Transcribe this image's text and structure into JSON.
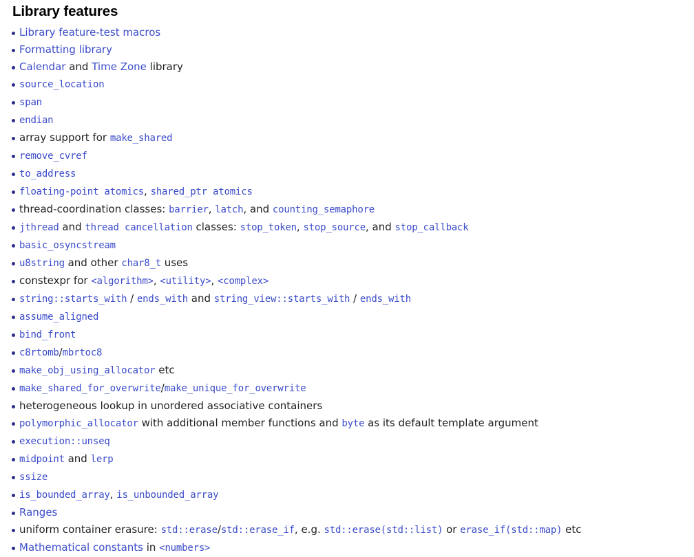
{
  "page": {
    "heading": "Library features"
  },
  "colors": {
    "link": "#3b4cca",
    "text": "#202122",
    "bullet": "#2d2d8c",
    "background": "#ffffff"
  },
  "items": [
    {
      "id": "library-feature-test-macros",
      "parts": [
        {
          "t": "Library feature-test macros",
          "k": "link",
          "m": false
        }
      ]
    },
    {
      "id": "formatting-library",
      "parts": [
        {
          "t": "Formatting library",
          "k": "link",
          "m": false
        }
      ]
    },
    {
      "id": "calendar-and-time-zone-library",
      "parts": [
        {
          "t": "Calendar",
          "k": "link",
          "m": false
        },
        {
          "t": " and ",
          "k": "text",
          "m": false
        },
        {
          "t": "Time Zone",
          "k": "link",
          "m": false
        },
        {
          "t": " library",
          "k": "text",
          "m": false
        }
      ]
    },
    {
      "id": "source-location",
      "parts": [
        {
          "t": "source_location",
          "k": "link",
          "m": true
        }
      ]
    },
    {
      "id": "span",
      "parts": [
        {
          "t": "span",
          "k": "link",
          "m": true
        }
      ]
    },
    {
      "id": "endian",
      "parts": [
        {
          "t": "endian",
          "k": "link",
          "m": true
        }
      ]
    },
    {
      "id": "array-support-for-make-shared",
      "parts": [
        {
          "t": "array support for ",
          "k": "text",
          "m": false
        },
        {
          "t": "make_shared",
          "k": "link",
          "m": true
        }
      ]
    },
    {
      "id": "remove-cvref",
      "parts": [
        {
          "t": "remove_cvref",
          "k": "link",
          "m": true
        }
      ]
    },
    {
      "id": "to-address",
      "parts": [
        {
          "t": "to_address",
          "k": "link",
          "m": true
        }
      ]
    },
    {
      "id": "floating-point-atomics",
      "parts": [
        {
          "t": "floating-point atomics",
          "k": "link",
          "m": true
        },
        {
          "t": ", ",
          "k": "text",
          "m": false
        },
        {
          "t": "shared_ptr atomics",
          "k": "link",
          "m": true
        }
      ]
    },
    {
      "id": "thread-coordination-classes",
      "parts": [
        {
          "t": "thread-coordination classes: ",
          "k": "text",
          "m": false
        },
        {
          "t": "barrier",
          "k": "link",
          "m": true
        },
        {
          "t": ", ",
          "k": "text",
          "m": false
        },
        {
          "t": "latch",
          "k": "link",
          "m": true
        },
        {
          "t": ", and ",
          "k": "text",
          "m": false
        },
        {
          "t": "counting_semaphore",
          "k": "link",
          "m": true
        }
      ]
    },
    {
      "id": "jthread-and-thread-cancellation",
      "parts": [
        {
          "t": "jthread",
          "k": "link",
          "m": true
        },
        {
          "t": " and ",
          "k": "text",
          "m": false
        },
        {
          "t": "thread cancellation",
          "k": "link",
          "m": true
        },
        {
          "t": " classes: ",
          "k": "text",
          "m": false
        },
        {
          "t": "stop_token",
          "k": "link",
          "m": true
        },
        {
          "t": ", ",
          "k": "text",
          "m": false
        },
        {
          "t": "stop_source",
          "k": "link",
          "m": true
        },
        {
          "t": ", and ",
          "k": "text",
          "m": false
        },
        {
          "t": "stop_callback",
          "k": "link",
          "m": true
        }
      ]
    },
    {
      "id": "basic-osyncstream",
      "parts": [
        {
          "t": "basic_osyncstream",
          "k": "link",
          "m": true
        }
      ]
    },
    {
      "id": "u8string-and-char8-t",
      "parts": [
        {
          "t": "u8string",
          "k": "link",
          "m": true
        },
        {
          "t": " and other ",
          "k": "text",
          "m": false
        },
        {
          "t": "char8_t",
          "k": "link",
          "m": true
        },
        {
          "t": " uses",
          "k": "text",
          "m": false
        }
      ]
    },
    {
      "id": "constexpr-for-headers",
      "parts": [
        {
          "t": "constexpr for ",
          "k": "text",
          "m": false
        },
        {
          "t": "<algorithm>",
          "k": "link",
          "m": true
        },
        {
          "t": ", ",
          "k": "text",
          "m": false
        },
        {
          "t": "<utility>",
          "k": "link",
          "m": true
        },
        {
          "t": ", ",
          "k": "text",
          "m": false
        },
        {
          "t": "<complex>",
          "k": "link",
          "m": true
        }
      ]
    },
    {
      "id": "string-starts-with-ends-with",
      "parts": [
        {
          "t": "string::starts_with",
          "k": "link",
          "m": true
        },
        {
          "t": " / ",
          "k": "text",
          "m": false
        },
        {
          "t": "ends_with",
          "k": "link",
          "m": true
        },
        {
          "t": " and ",
          "k": "text",
          "m": false
        },
        {
          "t": "string_view::starts_with",
          "k": "link",
          "m": true
        },
        {
          "t": " / ",
          "k": "text",
          "m": false
        },
        {
          "t": "ends_with",
          "k": "link",
          "m": true
        }
      ]
    },
    {
      "id": "assume-aligned",
      "parts": [
        {
          "t": "assume_aligned",
          "k": "link",
          "m": true
        }
      ]
    },
    {
      "id": "bind-front",
      "parts": [
        {
          "t": "bind_front",
          "k": "link",
          "m": true
        }
      ]
    },
    {
      "id": "c8rtomb-mbrtoc8",
      "parts": [
        {
          "t": "c8rtomb",
          "k": "link",
          "m": true
        },
        {
          "t": "/",
          "k": "text",
          "m": false
        },
        {
          "t": "mbrtoc8",
          "k": "link",
          "m": true
        }
      ]
    },
    {
      "id": "make-obj-using-allocator",
      "parts": [
        {
          "t": "make_obj_using_allocator",
          "k": "link",
          "m": true
        },
        {
          "t": " etc",
          "k": "text",
          "m": false
        }
      ]
    },
    {
      "id": "make-shared-for-overwrite",
      "parts": [
        {
          "t": "make_shared_for_overwrite",
          "k": "link",
          "m": true
        },
        {
          "t": "/",
          "k": "text",
          "m": false
        },
        {
          "t": "make_unique_for_overwrite",
          "k": "link",
          "m": true
        }
      ]
    },
    {
      "id": "heterogeneous-lookup",
      "parts": [
        {
          "t": "heterogeneous lookup in unordered associative containers",
          "k": "text",
          "m": false
        }
      ]
    },
    {
      "id": "polymorphic-allocator",
      "parts": [
        {
          "t": "polymorphic_allocator",
          "k": "link",
          "m": true
        },
        {
          "t": " with additional member functions and ",
          "k": "text",
          "m": false
        },
        {
          "t": "byte",
          "k": "link",
          "m": true
        },
        {
          "t": " as its default template argument",
          "k": "text",
          "m": false
        }
      ]
    },
    {
      "id": "execution-unseq",
      "parts": [
        {
          "t": "execution::unseq",
          "k": "link",
          "m": true
        }
      ]
    },
    {
      "id": "midpoint-and-lerp",
      "parts": [
        {
          "t": "midpoint",
          "k": "link",
          "m": true
        },
        {
          "t": " and ",
          "k": "text",
          "m": false
        },
        {
          "t": "lerp",
          "k": "link",
          "m": true
        }
      ]
    },
    {
      "id": "ssize",
      "parts": [
        {
          "t": "ssize",
          "k": "link",
          "m": true
        }
      ]
    },
    {
      "id": "is-bounded-array",
      "parts": [
        {
          "t": "is_bounded_array",
          "k": "link",
          "m": true
        },
        {
          "t": ", ",
          "k": "text",
          "m": false
        },
        {
          "t": "is_unbounded_array",
          "k": "link",
          "m": true
        }
      ]
    },
    {
      "id": "ranges",
      "parts": [
        {
          "t": "Ranges",
          "k": "link",
          "m": false
        }
      ]
    },
    {
      "id": "uniform-container-erasure",
      "parts": [
        {
          "t": "uniform container erasure: ",
          "k": "text",
          "m": false
        },
        {
          "t": "std::erase",
          "k": "link",
          "m": true
        },
        {
          "t": "/",
          "k": "text",
          "m": false
        },
        {
          "t": "std::erase_if",
          "k": "link",
          "m": true
        },
        {
          "t": ", e.g. ",
          "k": "text",
          "m": false
        },
        {
          "t": "std::erase(std::list)",
          "k": "link",
          "m": true
        },
        {
          "t": " or ",
          "k": "text",
          "m": false
        },
        {
          "t": "erase_if(std::map)",
          "k": "link",
          "m": true
        },
        {
          "t": " etc",
          "k": "text",
          "m": false
        }
      ]
    },
    {
      "id": "mathematical-constants",
      "parts": [
        {
          "t": "Mathematical constants",
          "k": "link",
          "m": false
        },
        {
          "t": " in ",
          "k": "text",
          "m": false
        },
        {
          "t": "<numbers>",
          "k": "link",
          "m": true
        }
      ]
    }
  ]
}
